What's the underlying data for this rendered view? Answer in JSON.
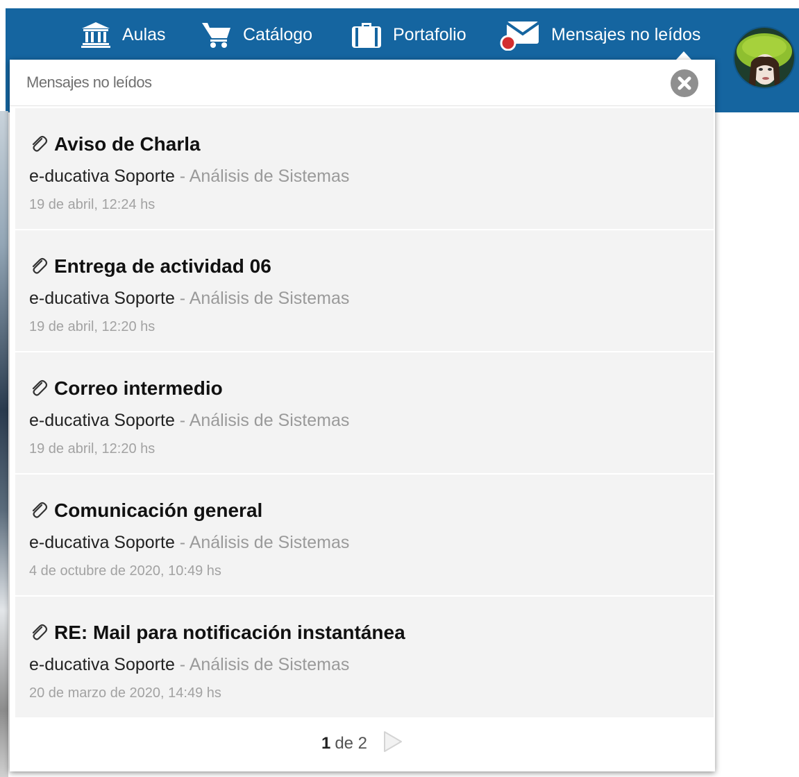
{
  "nav": {
    "items": [
      {
        "label": "Aulas",
        "icon": "institution-icon"
      },
      {
        "label": "Catálogo",
        "icon": "cart-icon"
      },
      {
        "label": "Portafolio",
        "icon": "briefcase-icon"
      },
      {
        "label": "Mensajes no leídos",
        "icon": "envelope-icon",
        "active": true,
        "badge_color": "#d32f2f"
      }
    ],
    "bar_color": "#1565a0"
  },
  "panel": {
    "title": "Mensajes no leídos",
    "messages": [
      {
        "subject": "Aviso de Charla",
        "sender": "e-ducativa Soporte",
        "separator": " - ",
        "course": "Análisis de Sistemas",
        "date": "19 de abril, 12:24 hs"
      },
      {
        "subject": "Entrega de actividad 06",
        "sender": "e-ducativa Soporte",
        "separator": " - ",
        "course": "Análisis de Sistemas",
        "date": "19 de abril, 12:20 hs"
      },
      {
        "subject": "Correo intermedio",
        "sender": "e-ducativa Soporte",
        "separator": " - ",
        "course": "Análisis de Sistemas",
        "date": "19 de abril, 12:20 hs"
      },
      {
        "subject": "Comunicación general",
        "sender": "e-ducativa Soporte",
        "separator": " - ",
        "course": "Análisis de Sistemas",
        "date": "4 de octubre de 2020, 10:49 hs"
      },
      {
        "subject": "RE: Mail para notificación instantánea",
        "sender": "e-ducativa Soporte",
        "separator": " - ",
        "course": "Análisis de Sistemas",
        "date": "20 de marzo de 2020, 14:49 hs"
      }
    ],
    "pager": {
      "current": "1",
      "of_text": "de 2"
    }
  }
}
